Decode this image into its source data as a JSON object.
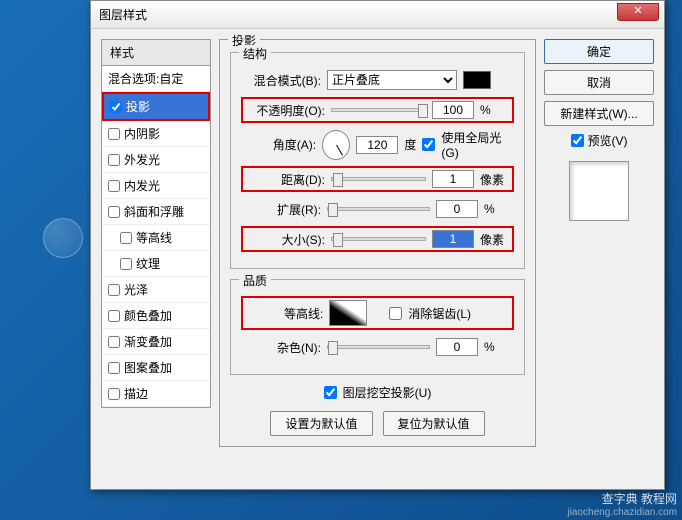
{
  "window": {
    "title": "图层样式"
  },
  "sidebar": {
    "header": "样式",
    "items": [
      {
        "label": "混合选项:自定",
        "checkbox": false
      },
      {
        "label": "投影",
        "checked": true,
        "selected": true
      },
      {
        "label": "内阴影",
        "checked": false
      },
      {
        "label": "外发光",
        "checked": false
      },
      {
        "label": "内发光",
        "checked": false
      },
      {
        "label": "斜面和浮雕",
        "checked": false
      },
      {
        "label": "等高线",
        "checked": false,
        "indent": true
      },
      {
        "label": "纹理",
        "checked": false,
        "indent": true
      },
      {
        "label": "光泽",
        "checked": false
      },
      {
        "label": "颜色叠加",
        "checked": false
      },
      {
        "label": "渐变叠加",
        "checked": false
      },
      {
        "label": "图案叠加",
        "checked": false
      },
      {
        "label": "描边",
        "checked": false
      }
    ]
  },
  "panel": {
    "title": "投影",
    "structure": {
      "title": "结构",
      "blend_mode_label": "混合模式(B):",
      "blend_mode_value": "正片叠底",
      "opacity_label": "不透明度(O):",
      "opacity_value": "100",
      "opacity_unit": "%",
      "angle_label": "角度(A):",
      "angle_value": "120",
      "angle_unit": "度",
      "global_light": "使用全局光(G)",
      "distance_label": "距离(D):",
      "distance_value": "1",
      "distance_unit": "像素",
      "spread_label": "扩展(R):",
      "spread_value": "0",
      "spread_unit": "%",
      "size_label": "大小(S):",
      "size_value": "1",
      "size_unit": "像素"
    },
    "quality": {
      "title": "品质",
      "contour_label": "等高线:",
      "antialias": "消除锯齿(L)",
      "noise_label": "杂色(N):",
      "noise_value": "0",
      "noise_unit": "%"
    },
    "knockout": "图层挖空投影(U)",
    "make_default": "设置为默认值",
    "reset_default": "复位为默认值"
  },
  "buttons": {
    "ok": "确定",
    "cancel": "取消",
    "new_style": "新建样式(W)...",
    "preview": "预览(V)"
  },
  "watermark": {
    "brand": "查字典 教程网",
    "url": "jiaocheng.chazidian.com"
  }
}
